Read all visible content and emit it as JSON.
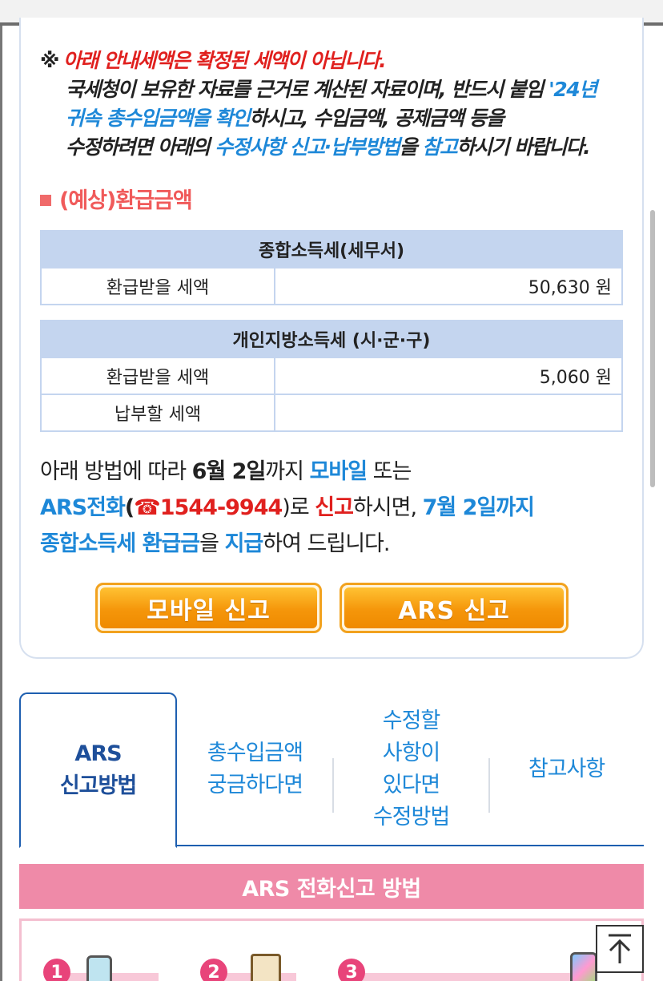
{
  "notice": {
    "mark": "※",
    "line1": "아래 안내세액은 확정된 세액이 아닙니다.",
    "line2a": "국세청이 보유한 자료를 근거로 계산된 자료이며, 반드시 붙임 ",
    "line2b": "'24년",
    "line3a": "귀속 총수입금액을 확인",
    "line3b": "하시고, 수입금액, 공제금액 등을",
    "line4a": "수정하려면 아래의 ",
    "line4b": "수정사항 신고·납부방법",
    "line4c": "을 ",
    "line4d": "참고",
    "line4e": "하시기 바랍니다."
  },
  "refund": {
    "section_title": "(예상)환급금액",
    "national": {
      "header": "종합소득세(세무서)",
      "rows": [
        {
          "label": "환급받을 세액",
          "value": "50,630 원"
        }
      ]
    },
    "local": {
      "header": "개인지방소득세 (시·군·구)",
      "rows": [
        {
          "label": "환급받을 세액",
          "value": "5,060 원"
        },
        {
          "label": "납부할 세액",
          "value": ""
        }
      ]
    }
  },
  "guide": {
    "p1": "아래 방법에 따라 ",
    "p2": "6월 2일",
    "p3": "까지 ",
    "p4": "모바일",
    "p5": " 또는",
    "p6": "ARS전화",
    "p7": "(",
    "p8": "☎",
    "p9": "1544-9944",
    "p10": ")로 ",
    "p11": "신고",
    "p12": "하시면, ",
    "p13": "7월 2일까지",
    "p14": "종합소득세 환급금",
    "p15": "을 ",
    "p16": "지급",
    "p17": "하여 드립니다."
  },
  "buttons": {
    "mobile": "모바일 신고",
    "ars": "ARS 신고"
  },
  "tabs": [
    {
      "line1": "ARS",
      "line2": "신고방법"
    },
    {
      "line1": "총수입금액",
      "line2": "궁금하다면"
    },
    {
      "line1": "수정할",
      "line2": "사항이",
      "line3": "있다면",
      "line4": "수정방법"
    },
    {
      "line1": "참고사항"
    }
  ],
  "ars_section": {
    "title": "ARS 전화신고 방법",
    "steps": [
      "1",
      "2",
      "3"
    ]
  },
  "colors": {
    "accent_blue": "#1e88d8",
    "accent_red": "#e0201e",
    "table_header": "#c4d5ef",
    "button_orange": "#f5960a",
    "pink_banner": "#ef8aa8"
  }
}
